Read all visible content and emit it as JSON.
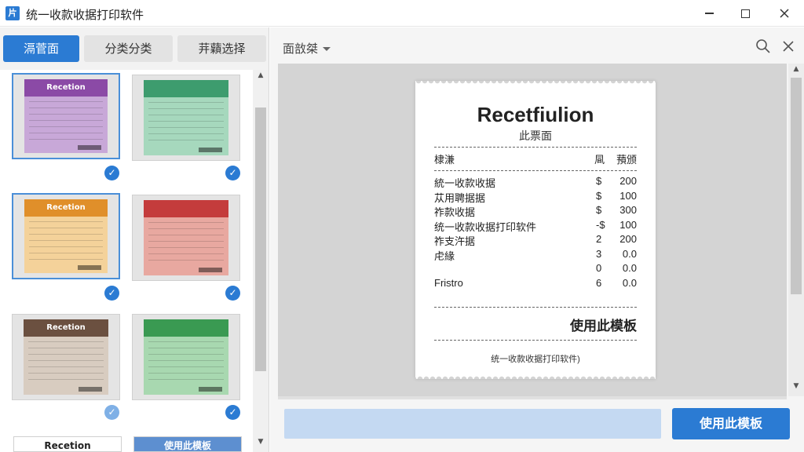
{
  "app": {
    "title": "统一收款收据打印软件",
    "icon_glyph": "片"
  },
  "tabs": [
    {
      "label": "滆菅面",
      "active": true
    },
    {
      "label": "分类分类",
      "active": false
    },
    {
      "label": "茾蘔选择",
      "active": false
    }
  ],
  "thumbnails": [
    {
      "band_text": "Recetion",
      "band_color": "#8b4aa6",
      "paper_color": "#c8a8d8",
      "selected": true,
      "checked": true
    },
    {
      "band_text": "",
      "band_color": "#3d9c6e",
      "paper_color": "#a6d8bd",
      "selected": false,
      "checked": true
    },
    {
      "band_text": "Recetion",
      "band_color": "#e08f2a",
      "paper_color": "#f4d29a",
      "selected": true,
      "checked": true
    },
    {
      "band_text": "",
      "band_color": "#c43c3c",
      "paper_color": "#e8a8a0",
      "selected": false,
      "checked": true
    },
    {
      "band_text": "Recetion",
      "band_color": "#6b5040",
      "paper_color": "#d8ccc0",
      "selected": false,
      "checked": true
    },
    {
      "band_text": "",
      "band_color": "#3a9a52",
      "paper_color": "#a8d8b0",
      "selected": false,
      "checked": true
    }
  ],
  "partial_thumbs": [
    {
      "text": "Recetion",
      "style": "plain"
    },
    {
      "text": "使用此模板",
      "style": "blue"
    }
  ],
  "preview": {
    "label": "面敨桀",
    "receipt": {
      "title": "Recetfiulion",
      "subtitle": "此票面",
      "headers": [
        "棣溓",
        "凬",
        "蕷颁"
      ],
      "rows": [
        {
          "name": "統一收款收据",
          "sym": "$",
          "amt": "200"
        },
        {
          "name": "苁用聘据据",
          "sym": "$",
          "amt": "100"
        },
        {
          "name": "祚款收据",
          "sym": "$",
          "amt": "300"
        },
        {
          "name": "统一收款收据打印软件",
          "sym": "-$",
          "amt": "100"
        },
        {
          "name": "祚支汻据",
          "sym": "2",
          "amt": "200"
        },
        {
          "name": "虍緣",
          "sym": "3",
          "amt": "0.0"
        },
        {
          "name": "",
          "sym": "0",
          "amt": "0.0"
        },
        {
          "name": "Fristro",
          "sym": "6",
          "amt": "0.0"
        }
      ],
      "use_label": "使用此模板",
      "footer": "统一收款收据打印软件)"
    }
  },
  "buttons": {
    "use_template": "使用此模板"
  }
}
